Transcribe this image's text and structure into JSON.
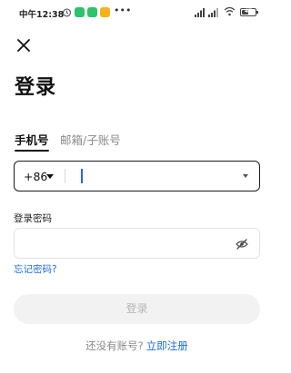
{
  "status_bar": {
    "time": "中午12:38",
    "icons": [
      "alarm-icon",
      "wechat-icon",
      "wechat-icon",
      "note-icon",
      "more-icon",
      "signal-icon",
      "signal-icon",
      "wifi-icon",
      "battery-icon"
    ],
    "battery": "47",
    "more": "•••"
  },
  "header": {
    "close_icon": "close-icon",
    "title": "登录"
  },
  "tabs": [
    {
      "label": "手机号",
      "active": true
    },
    {
      "label": "邮箱/子账号",
      "active": false
    }
  ],
  "phone_field": {
    "country_code": "+86",
    "value": "",
    "placeholder": ""
  },
  "password_field": {
    "label": "登录密码",
    "value": "",
    "placeholder": "",
    "visibility_icon": "eye-off-icon"
  },
  "forgot_password": "忘记密码?",
  "login_button": "登录",
  "register": {
    "question": "还没有账号?",
    "link": "立即注册"
  },
  "colors": {
    "accent": "#1d6fe0",
    "cursor": "#2d63e0",
    "disabled_button_bg": "#f2f2f2",
    "disabled_button_text": "#b5b5b5"
  }
}
